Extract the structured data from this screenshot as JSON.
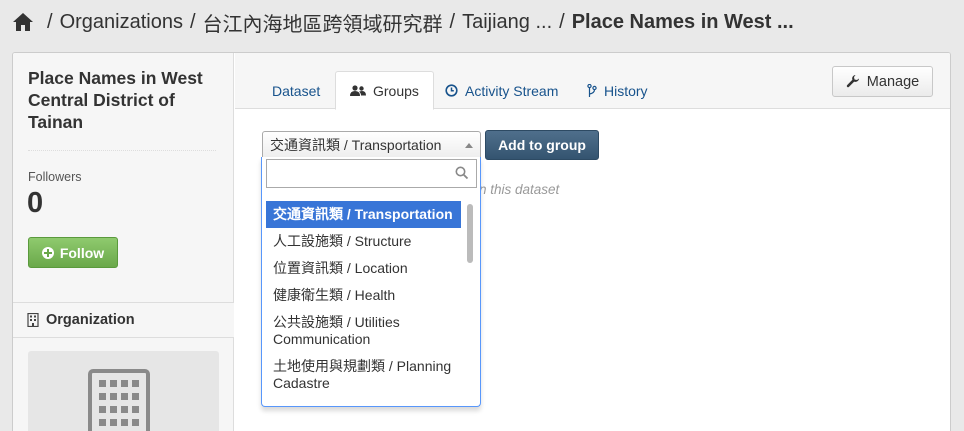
{
  "breadcrumb": {
    "items": [
      {
        "label": "Organizations"
      },
      {
        "label": "台江內海地區跨領域研究群"
      },
      {
        "label": "Taijiang ..."
      },
      {
        "label": "Place Names in West ..."
      }
    ],
    "separator": "/"
  },
  "sidebar": {
    "title": "Place Names in West Central District of Tainan",
    "followers_label": "Followers",
    "followers_count": "0",
    "follow_button": "Follow",
    "organization_heading": "Organization"
  },
  "tabs": [
    {
      "label": "Dataset",
      "icon": "none"
    },
    {
      "label": "Groups",
      "icon": "users-icon",
      "active": true
    },
    {
      "label": "Activity Stream",
      "icon": "clock-icon"
    },
    {
      "label": "History",
      "icon": "branch-icon"
    }
  ],
  "manage_button": "Manage",
  "group_select": {
    "selected": "交通資訊類 / Transportation",
    "search_value": "",
    "options": [
      "交通資訊類 / Transportation",
      "人工設施類 / Structure",
      "位置資訊類 / Location",
      "健康衛生類 / Health",
      "公共設施類 / Utilities Communication",
      "土地使用與規劃類 / Planning Cadastre"
    ],
    "highlighted_index": 0
  },
  "add_to_group_button": "Add to group",
  "empty_message": "n this dataset",
  "colors": {
    "accent_link": "#18538c",
    "follow_green": "#6aa84a",
    "primary_button": "#345470",
    "highlight": "#3875d7"
  }
}
